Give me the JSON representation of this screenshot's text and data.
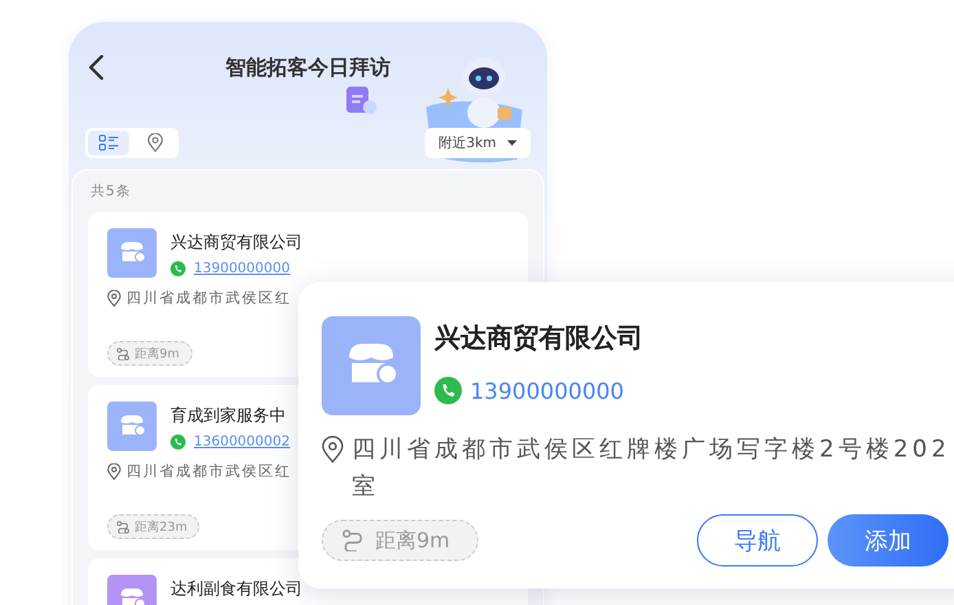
{
  "header": {
    "title": "智能拓客今日拜访"
  },
  "view_toggle": [
    {
      "kind": "list",
      "selected": true
    },
    {
      "kind": "map",
      "selected": false
    }
  ],
  "filter": {
    "label": "附近3km"
  },
  "list": {
    "count": "共5条",
    "items": [
      {
        "name": "兴达商贸有限公司",
        "phone": "13900000000",
        "address": "四川省成都市武侯区红",
        "distance": "距离9m",
        "color": "#9bb4f9"
      },
      {
        "name": "育成到家服务中",
        "phone": "13600000002",
        "address": "四川省成都市武侯区红",
        "distance": "距离23m",
        "color": "#9bb4f9"
      },
      {
        "name": "达利副食有限公司",
        "color": "#b592f5"
      }
    ]
  },
  "popup": {
    "name": "兴达商贸有限公司",
    "phone": "13900000000",
    "address": "四川省成都市武侯区红牌楼广场写字楼2号楼202室",
    "distance": "距离9m",
    "color": "#9bb4f9",
    "buttons": [
      {
        "label": "导航",
        "kind": "outline"
      },
      {
        "label": "添加",
        "kind": "primary"
      }
    ]
  }
}
